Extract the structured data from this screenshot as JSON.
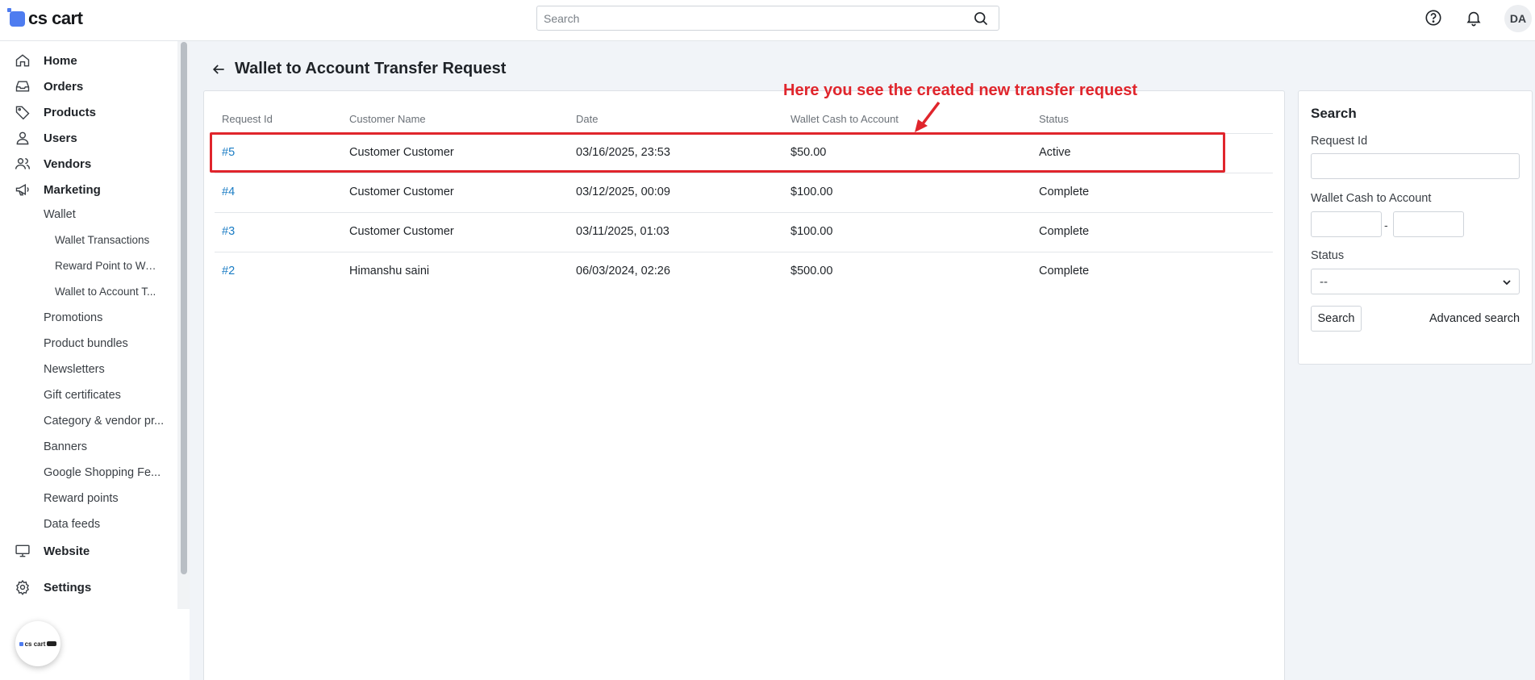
{
  "app": {
    "logo_text": "cs cart",
    "brand_color": "#4e7cf0"
  },
  "topbar": {
    "search_placeholder": "Search",
    "icons": [
      "help-icon",
      "bell-icon"
    ],
    "avatar_initials": "DA"
  },
  "sidebar": {
    "items": [
      {
        "label": "Home",
        "icon": "home-icon"
      },
      {
        "label": "Orders",
        "icon": "inbox-icon"
      },
      {
        "label": "Products",
        "icon": "tag-icon"
      },
      {
        "label": "Users",
        "icon": "user-icon"
      },
      {
        "label": "Vendors",
        "icon": "users-icon"
      },
      {
        "label": "Marketing",
        "icon": "megaphone-icon"
      }
    ],
    "marketing_sub": {
      "wallet": "Wallet",
      "wallet_sub": [
        "Wallet Transactions",
        "Reward Point to Wa...",
        "Wallet to Account T..."
      ],
      "others": [
        "Promotions",
        "Product bundles",
        "Newsletters",
        "Gift certificates",
        "Category & vendor pr...",
        "Banners",
        "Google Shopping Fe...",
        "Reward points",
        "Data feeds"
      ]
    },
    "website": {
      "label": "Website",
      "icon": "monitor-icon"
    },
    "settings": {
      "label": "Settings",
      "icon": "gear-icon"
    },
    "bubble_text": "cs cart"
  },
  "page": {
    "title": "Wallet to Account Transfer Request"
  },
  "table": {
    "headers": [
      "Request Id",
      "Customer Name",
      "Date",
      "Wallet Cash to Account",
      "Status"
    ],
    "rows": [
      {
        "id": "#5",
        "customer": "Customer Customer",
        "date": "03/16/2025, 23:53",
        "amount": "$50.00",
        "status": "Active"
      },
      {
        "id": "#4",
        "customer": "Customer Customer",
        "date": "03/12/2025, 00:09",
        "amount": "$100.00",
        "status": "Complete"
      },
      {
        "id": "#3",
        "customer": "Customer Customer",
        "date": "03/11/2025, 01:03",
        "amount": "$100.00",
        "status": "Complete"
      },
      {
        "id": "#2",
        "customer": "Himanshu saini",
        "date": "06/03/2024, 02:26",
        "amount": "$500.00",
        "status": "Complete"
      }
    ]
  },
  "annotation": {
    "text": "Here you see the created new transfer request",
    "color": "#e0252c"
  },
  "search_panel": {
    "title": "Search",
    "request_id_label": "Request Id",
    "amount_label": "Wallet Cash to Account",
    "range_separator": "-",
    "status_label": "Status",
    "status_value": "--",
    "search_button": "Search",
    "advanced_link": "Advanced search"
  }
}
